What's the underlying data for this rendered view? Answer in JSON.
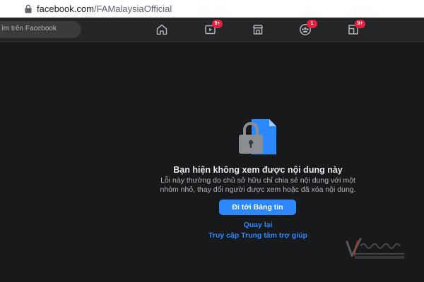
{
  "browser": {
    "url_host": "facebook.com",
    "url_path": "/FAMalaysiaOfficial"
  },
  "nav": {
    "search_placeholder": "ìm trên Facebook",
    "icons": [
      {
        "name": "home-icon",
        "badge": ""
      },
      {
        "name": "watch-icon",
        "badge": "9+"
      },
      {
        "name": "marketplace-icon",
        "badge": ""
      },
      {
        "name": "groups-icon",
        "badge": "1"
      },
      {
        "name": "gaming-icon",
        "badge": "9+"
      }
    ]
  },
  "content": {
    "illustration": "locked-document-icon",
    "title": "Bạn hiện không xem được nội dung này",
    "desc_line1": "Lỗi này thường do chủ sở hữu chỉ chia sẻ nội dung với một",
    "desc_line2": "nhóm nhỏ, thay đổi người được xem hoặc đã xóa nội dung.",
    "primary_button": "Đi tới Bảng tin",
    "back_link": "Quay lại",
    "help_link": "Truy cập Trung tâm trợ giúp"
  },
  "watermark": {
    "icon": "vietnamnet-logo"
  },
  "colors": {
    "page_bg": "#18191a",
    "nav_bg": "#242526",
    "accent": "#2d88ff",
    "badge": "#e41e3f"
  }
}
